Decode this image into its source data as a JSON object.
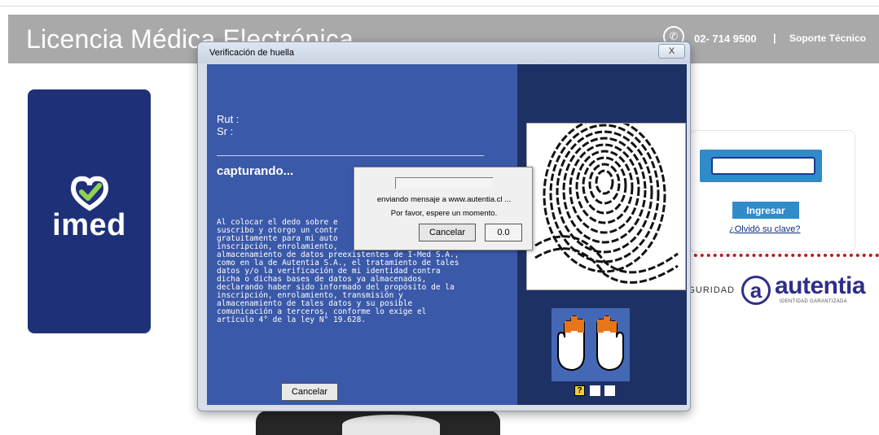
{
  "page": {
    "header_title": "Licencia Médica Electrónica",
    "phone": "02- 714 9500",
    "separator": "|",
    "support": "Soporte Técnico",
    "phone_icon": "phone-icon",
    "brand_logo": "imed",
    "login": {
      "username_value": "",
      "submit_label": "Ingresar",
      "forgot_label": "¿Olvidó su clave?"
    },
    "security": {
      "seguridad_label": "EGURIDAD",
      "autentia_mark": "a",
      "autentia_name": "autentia",
      "autentia_tagline": "IDENTIDAD GARANTIZADA"
    },
    "colors": {
      "brand_navy": "#1e3178",
      "accent_blue": "#2f8bc9",
      "indicator_red": "#c0161c"
    }
  },
  "dialog": {
    "title": "Verificación de huella",
    "close_label": "X",
    "rut_label": "Rut :",
    "sr_label": "Sr :",
    "status": "capturando...",
    "consent_lines": [
      "Al colocar el dedo sobre e",
      "suscribo y otorgo un contr",
      "gratuitamente para mi auto",
      "inscripción, enrolamiento,",
      "almacenamiento de datos preexistentes de I-Med S.A.,",
      "como en la de Autentia S.A., el tratamiento de tales",
      "datos y/o la verificación de mi identidad contra",
      "dicha o dichas bases de datos ya almacenados,",
      "declarando haber sido informado del propósito de la",
      "inscripción, enrolamiento, transmisión y",
      "almacenamiento de tales datos y su posible",
      "comunicación a terceros, conforme lo exige el",
      "artículo 4° de la ley N° 19.628."
    ],
    "cancel_label": "Cancelar",
    "hand_indicator": "?",
    "colors": {
      "panel_blue": "#3b59a9",
      "panel_dark": "#1e3164"
    }
  },
  "progress": {
    "message_line1": "enviando mensaje a www.autentia.cl ...",
    "message_line2": "Por favor, espere un momento.",
    "cancel_label": "Cancelar",
    "counter": "0.0",
    "progress_fraction": 0
  }
}
